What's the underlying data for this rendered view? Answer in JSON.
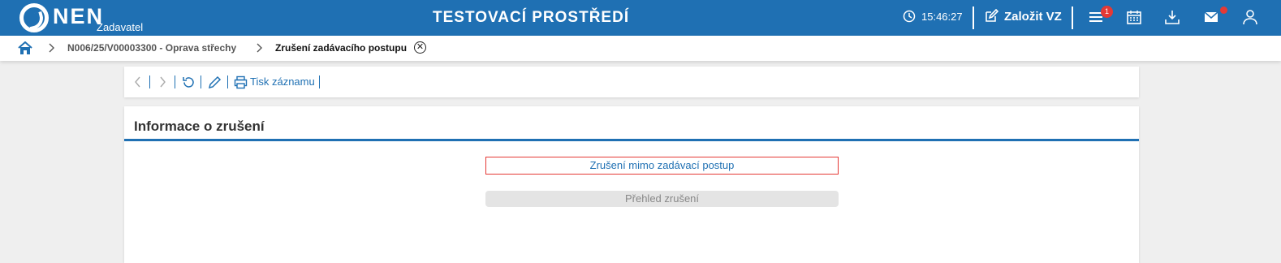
{
  "header": {
    "logo_text": "NEN",
    "logo_sub": "Zadavatel",
    "environment": "TESTOVACÍ PROSTŘEDÍ",
    "time": "15:46:27",
    "create_label": "Založit VZ",
    "notification_count": "1"
  },
  "breadcrumb": {
    "items": [
      "N006/25/V00003300 - Oprava střechy",
      "Zrušení zadávacího postupu"
    ]
  },
  "toolbar": {
    "print_label": "Tisk záznamu"
  },
  "panel": {
    "title": "Informace o zrušení",
    "button_outside": "Zrušení mimo zadávací postup",
    "button_overview": "Přehled zrušení"
  }
}
